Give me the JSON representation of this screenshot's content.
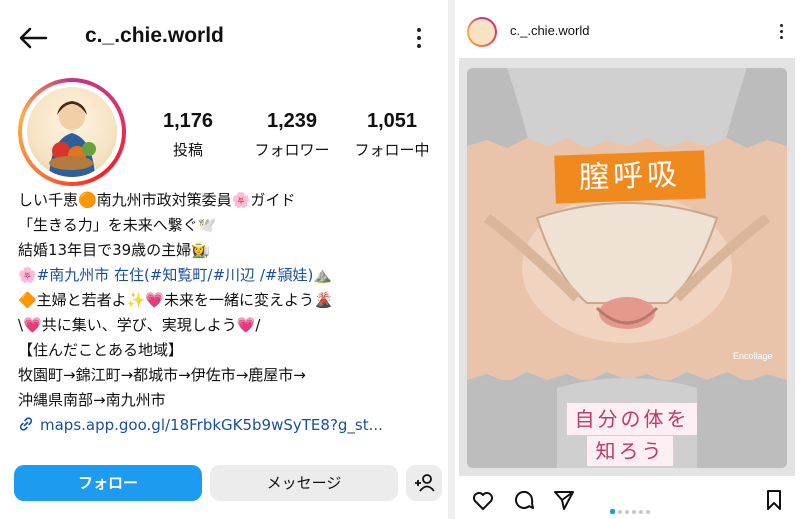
{
  "profile": {
    "username": "c._.chie.world",
    "stats": [
      {
        "value": "1,176",
        "label": "投稿"
      },
      {
        "value": "1,239",
        "label": "フォロワー"
      },
      {
        "value": "1,051",
        "label": "フォロー中"
      }
    ],
    "bio_lines": [
      "しい千恵🟠南九州市政対策委員🌸ガイド",
      "「生きる力」を未来へ繋ぐ🕊️",
      "結婚13年目で39歳の主婦👩‍🌾",
      "🌸#南九州市 在住(#知覧町/#川辺 /#頴娃)⛰️",
      "🔶主婦と若者よ✨💗未来を一緒に変えよう🌋",
      "\\💗共に集い、学び、実現しよう💗/",
      "【住んだことある地域】",
      "牧園町→錦江町→都城市→伊佐市→鹿屋市→",
      "沖縄県南部→南九州市"
    ],
    "link": "maps.app.goo.gl/18FrbkGK5b9wSyTE8?g_st...",
    "buttons": {
      "follow": "フォロー",
      "message": "メッセージ"
    }
  },
  "post": {
    "username": "c._.chie.world",
    "title": "膣呼吸",
    "subtitle_line1": "自分の体を",
    "subtitle_line2": "知ろう",
    "brand": "Encollage",
    "carousel_dots": 6,
    "active_dot": 0
  },
  "colors": {
    "follow_button": "#1d9bf0",
    "title_box": "#f08a1f",
    "hashtag": "#1a4fa0"
  }
}
